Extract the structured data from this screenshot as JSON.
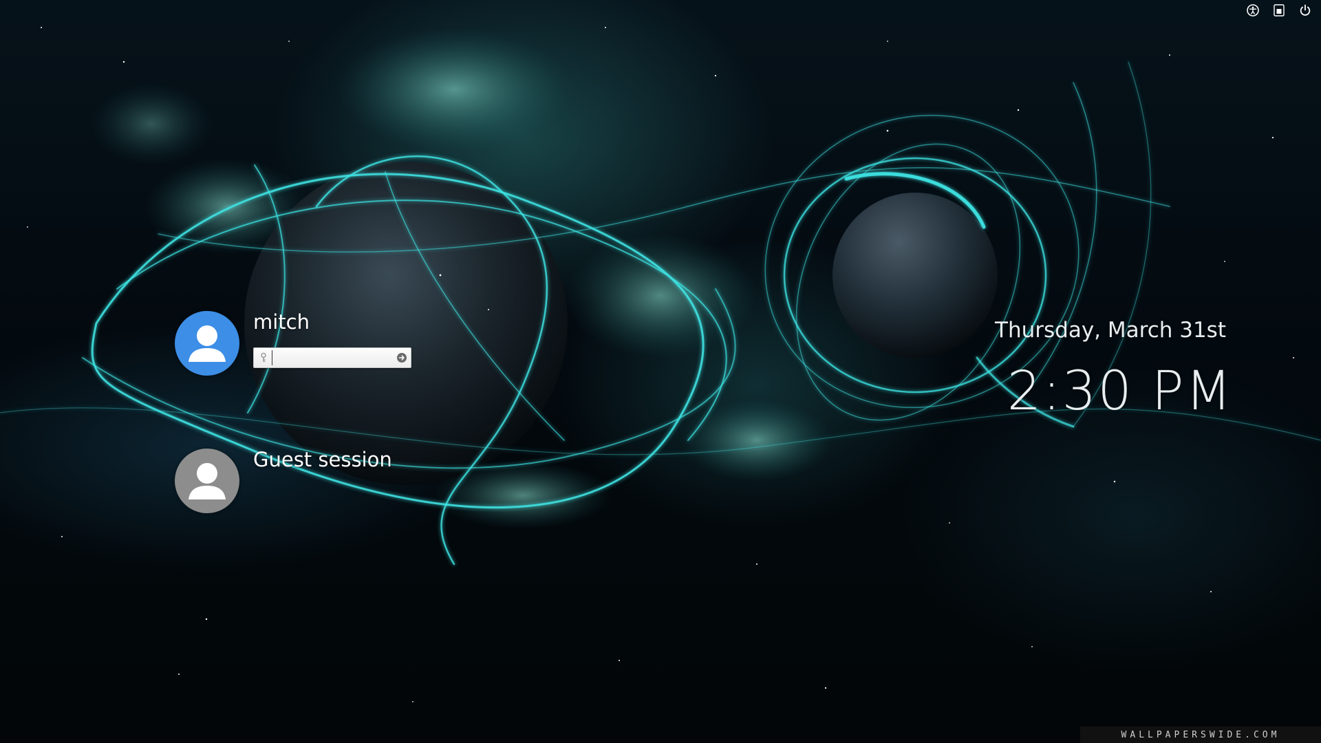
{
  "indicators": {
    "accessibility_icon": "accessibility-icon",
    "keyboard_layout_icon": "keyboard-layout-icon",
    "power_icon": "power-icon"
  },
  "users": [
    {
      "name": "mitch",
      "avatar_color": "#3d8ee6",
      "selected": true,
      "password_value": ""
    },
    {
      "name": "Guest session",
      "avatar_color": "#8d8d8d",
      "selected": false
    }
  ],
  "clock": {
    "date": "Thursday, March 31st",
    "time": "2:30 PM"
  },
  "watermark": {
    "text": "WALLPAPERSWIDE.COM"
  },
  "colors": {
    "accent_glow": "#3fe6e6",
    "avatar_blue": "#3d8ee6",
    "avatar_gray": "#8d8d8d"
  }
}
